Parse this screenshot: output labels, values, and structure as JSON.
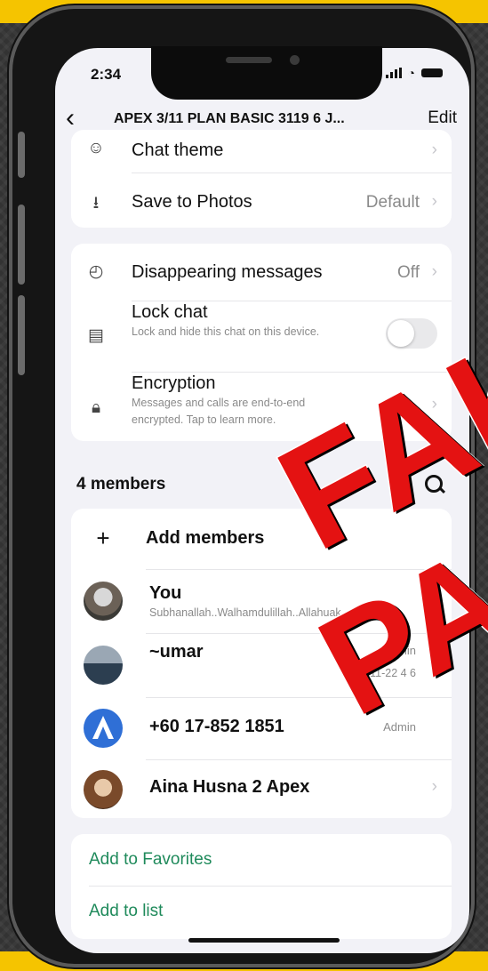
{
  "status_bar": {
    "time": "2:34"
  },
  "header": {
    "title": "APEX 3/11 PLAN BASIC 3119 6 J...",
    "edit_label": "Edit"
  },
  "settings": [
    {
      "label": "Chat theme"
    },
    {
      "label": "Save to Photos",
      "value": "Default"
    }
  ],
  "privacy": {
    "disappearing": {
      "label": "Disappearing messages",
      "value": "Off"
    },
    "lock": {
      "label": "Lock chat",
      "subtitle": "Lock and hide this chat on this device.",
      "enabled": false
    },
    "encryption": {
      "label": "Encryption",
      "subtitle": "Messages and calls are end-to-end encrypted. Tap to learn more."
    }
  },
  "members": {
    "header": "4 members",
    "add_label": "Add members",
    "list": [
      {
        "name": "You",
        "status": "Subhanallah..Walhamdulillah..Allahuak"
      },
      {
        "name": "~umar",
        "phone": "+60 11-22 4 6",
        "role": "Admin"
      },
      {
        "name": "+60 17-852 1851",
        "role": "Admin"
      },
      {
        "name": "Aina Husna 2 Apex"
      }
    ]
  },
  "actions": {
    "favorites": "Add to Favorites",
    "list": "Add to list"
  },
  "watermark": {
    "line1": "FAK",
    "line2": "PA"
  }
}
